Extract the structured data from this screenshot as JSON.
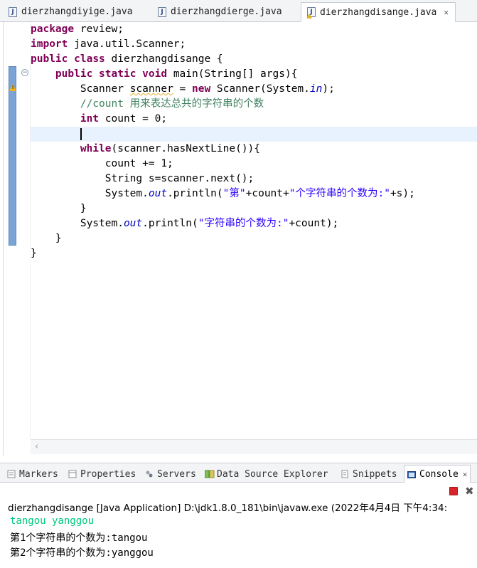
{
  "tabs": [
    {
      "label": "dierzhangdiyige.java",
      "active": false
    },
    {
      "label": "dierzhangdierge.java",
      "active": false
    },
    {
      "label": "dierzhangdisange.java",
      "active": true,
      "close": "✕"
    }
  ],
  "code": {
    "l1": {
      "kw": "package",
      "rest": " review;"
    },
    "l2": {
      "kw": "import",
      "rest": " java.util.Scanner;"
    },
    "l3": {
      "kw1": "public",
      "kw2": "class",
      "rest": " dierzhangdisange {"
    },
    "l4": {
      "indent": "    ",
      "kw1": "public",
      "kw2": "static",
      "kw3": "void",
      "rest": " main(String[] args){"
    },
    "l5": {
      "indent": "        ",
      "type": "Scanner ",
      "var": "scanner",
      "eq": " = ",
      "kw": "new",
      "mid": " Scanner(System.",
      "field": "in",
      "end": ");"
    },
    "l6": {
      "indent": "        ",
      "comment": "//count 用来表达总共的字符串的个数"
    },
    "l7": {
      "indent": "        ",
      "kw": "int",
      "rest": " count = 0;"
    },
    "l8": {
      "indent": "        "
    },
    "l9": {
      "indent": "        ",
      "kw": "while",
      "rest": "(scanner.hasNextLine()){"
    },
    "l10": {
      "text": "            count += 1;"
    },
    "l11": {
      "text": "            String s=scanner.next();"
    },
    "l12": {
      "indent": "            ",
      "pre": "System.",
      "field": "out",
      "mid": ".println(",
      "s1": "\"第\"",
      "mid2": "+count+",
      "s2": "\"个字符串的个数为:\"",
      "end": "+s);"
    },
    "l13": {
      "text": "        }"
    },
    "l14": {
      "indent": "        ",
      "pre": "System.",
      "field": "out",
      "mid": ".println(",
      "s1": "\"字符串的个数为:\"",
      "end": "+count);"
    },
    "l15": {
      "text": "    }"
    },
    "l16": {
      "text": "}"
    }
  },
  "views": {
    "markers": "Markers",
    "properties": "Properties",
    "servers": "Servers",
    "data_source": "Data Source Explorer",
    "snippets": "Snippets",
    "console": "Console",
    "close": "✕"
  },
  "console": {
    "header": "dierzhangdisange [Java Application] D:\\jdk1.8.0_181\\bin\\javaw.exe (2022年4月4日 下午4:34:",
    "input_line": "tangou yanggou",
    "output": [
      "第1个字符串的个数为:tangou",
      "第2个字符串的个数为:yanggou"
    ]
  },
  "colors": {
    "keyword": "#7f0055",
    "comment": "#3f7f5f",
    "string": "#2a00ff",
    "field": "#0000c0",
    "console_input": "#00c87d",
    "current_line": "#e8f2fe"
  }
}
